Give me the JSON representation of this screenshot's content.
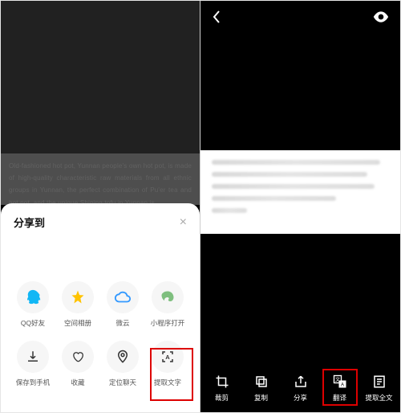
{
  "left": {
    "share_title": "分享到",
    "text_preview": "Old-fashioned hot pot, Yunnan people's own hot pot, is made of high-quality characteristic raw materials from all ethnic groups in Yunnan, the perfect combination of Pu'er tea and hot pot, and the unique Shiping tofu in Yunnan is",
    "grid": [
      {
        "label": "QQ好友"
      },
      {
        "label": "空间相册"
      },
      {
        "label": "微云"
      },
      {
        "label": "小程序打开"
      },
      {
        "label": "保存到手机"
      },
      {
        "label": "收藏"
      },
      {
        "label": "定位聊天"
      },
      {
        "label": "提取文字"
      }
    ]
  },
  "right": {
    "bottom_bar": [
      {
        "label": "裁剪"
      },
      {
        "label": "复制"
      },
      {
        "label": "分享"
      },
      {
        "label": "翻译"
      },
      {
        "label": "提取全文"
      }
    ]
  }
}
